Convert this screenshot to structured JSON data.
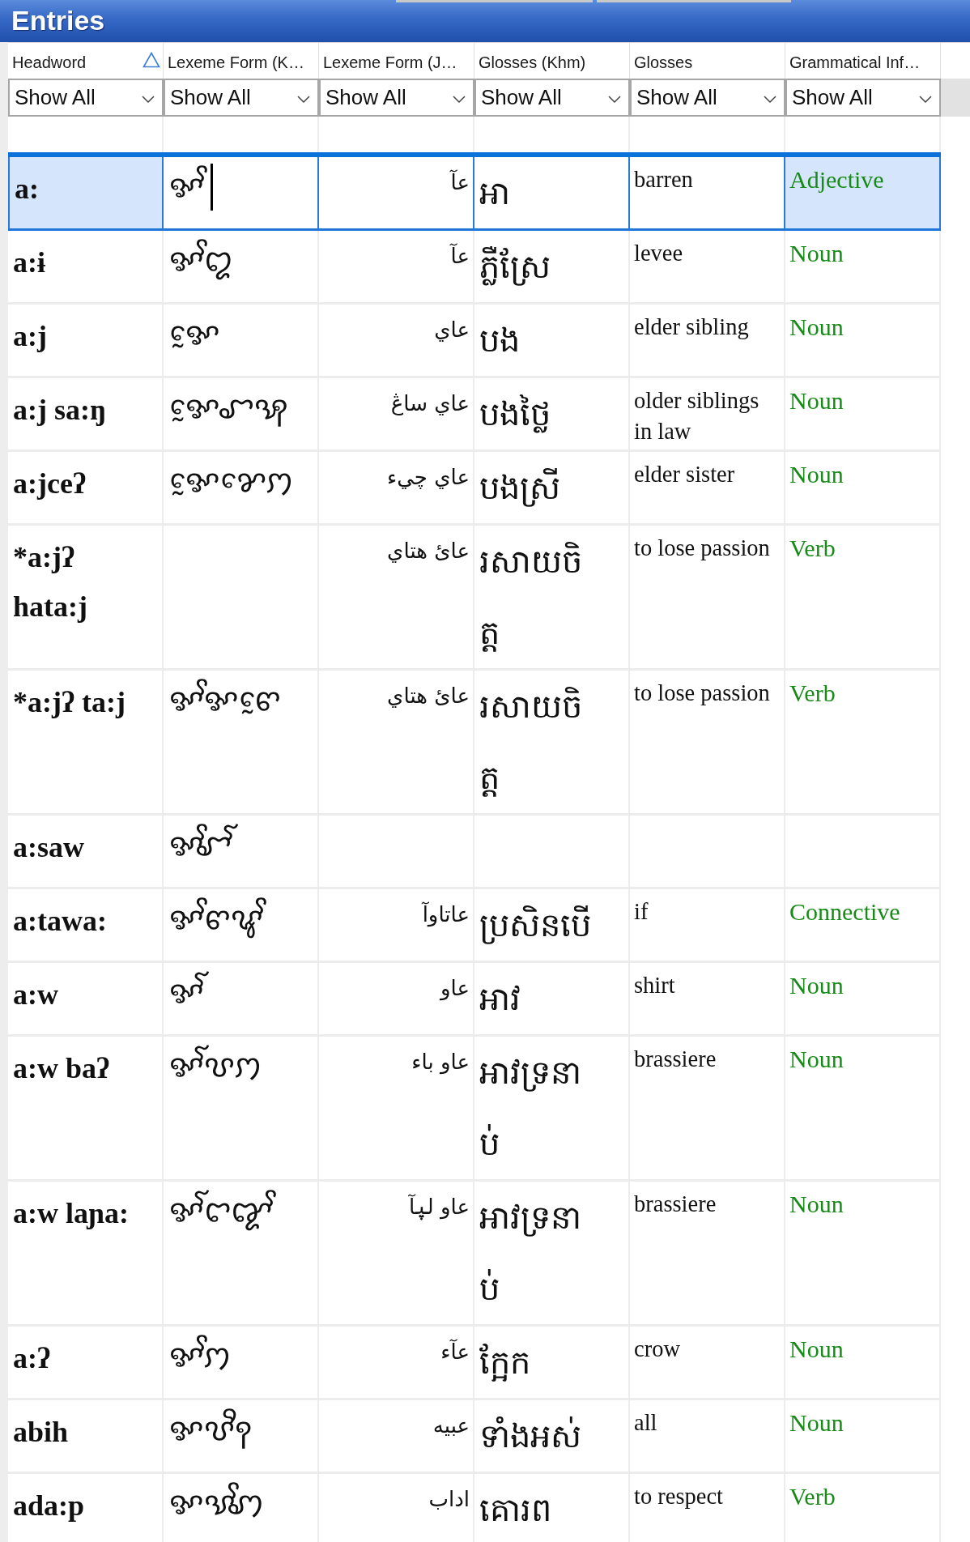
{
  "panel": {
    "title": "Entries"
  },
  "table": {
    "columns": [
      {
        "label": "Headword",
        "kind": "headword",
        "sorted": true,
        "filter": "Show All"
      },
      {
        "label": "Lexeme Form (K…",
        "kind": "cham",
        "sorted": false,
        "filter": "Show All"
      },
      {
        "label": "Lexeme Form (J…",
        "kind": "jawi",
        "sorted": false,
        "filter": "Show All"
      },
      {
        "label": "Glosses (Khm)",
        "kind": "khmer",
        "sorted": false,
        "filter": "Show All"
      },
      {
        "label": "Glosses",
        "kind": "gloss",
        "sorted": false,
        "filter": "Show All"
      },
      {
        "label": "Grammatical Inf…",
        "kind": "category",
        "sorted": false,
        "filter": "Show All"
      }
    ],
    "rows": [
      {
        "headword": "a:",
        "lexeme_form_k": "ꨀꨩ",
        "lexeme_form_j": "عآ",
        "glosses_khm": "អា",
        "glosses": "barren",
        "grammatical_info": "Adjective",
        "selected": true
      },
      {
        "headword": "a:ɨ",
        "lexeme_form_k": "ꨀꨩꨁ",
        "lexeme_form_j": "عآ",
        "glosses_khm": "ភ្លឺស្រែ",
        "glosses": "levee",
        "grammatical_info": "Noun",
        "selected": false
      },
      {
        "headword": "a:j",
        "lexeme_form_k": "ꨀꨰ",
        "lexeme_form_j": "عاي",
        "glosses_khm": "បង",
        "glosses": "elder sibling",
        "grammatical_info": "Noun",
        "selected": false
      },
      {
        "headword": "a:j sa:ŋ",
        "lexeme_form_k": "ꨀꨰꨧꩂ",
        "lexeme_form_j": "عاي ساڠ",
        "glosses_khm": "បងថ្លៃ",
        "glosses": "older siblings in law",
        "grammatical_info": "Noun",
        "selected": false
      },
      {
        "headword": "a:jceʔ",
        "lexeme_form_k": "ꨀꨰꨌꨯꩀ",
        "lexeme_form_j": "عاي چيء",
        "glosses_khm": "បងស្រី",
        "glosses": "elder sister",
        "grammatical_info": "Noun",
        "selected": false
      },
      {
        "headword": "*a:jʔ hata:j",
        "lexeme_form_j": "عائ هتاي",
        "glosses_khm": "រសាយចិត្ត",
        "glosses": "to lose passion",
        "grammatical_info": "Verb",
        "selected": false
      },
      {
        "headword": "*a:jʔ ta:j",
        "lexeme_form_k": "ꨀꨩꨀꨓꨰ",
        "lexeme_form_j": "عائ هتاي",
        "glosses_khm": "រសាយចិត្ត",
        "glosses": "to lose passion",
        "grammatical_info": "Verb",
        "selected": false
      },
      {
        "headword": "a:saw",
        "lexeme_form_k": "ꨀꨩꨧꨱ",
        "selected": false
      },
      {
        "headword": "a:tawa:",
        "lexeme_form_k": "ꨀꨩꨓꨥꨩ",
        "lexeme_form_j": "عاتاوآ",
        "glosses_khm": "ប្រសិនបើ",
        "glosses": "if",
        "grammatical_info": "Connective",
        "selected": false
      },
      {
        "headword": "a:w",
        "lexeme_form_k": "ꨀꨱ",
        "lexeme_form_j": "عاو",
        "glosses_khm": "អាវ",
        "glosses": "shirt",
        "grammatical_info": "Noun",
        "selected": false
      },
      {
        "headword": "a:w baʔ",
        "lexeme_form_k": "ꨀꨱꨝꩀ",
        "lexeme_form_j": "عاو باء",
        "glosses_khm": "អាវទ្រនាប់",
        "glosses": "brassiere",
        "grammatical_info": "Noun",
        "selected": false
      },
      {
        "headword": "a:w laɲa:",
        "lexeme_form_k": "ꨀꨱꨤꨑꨩ",
        "lexeme_form_j": "عاو لۑآ",
        "glosses_khm": "អាវទ្រនាប់",
        "glosses": "brassiere",
        "grammatical_info": "Noun",
        "selected": false
      },
      {
        "headword": "a:ʔ",
        "lexeme_form_k": "ꨀꨩꩀ",
        "lexeme_form_j": "عآء",
        "glosses_khm": "ក្អែក",
        "glosses": "crow",
        "grammatical_info": "Noun",
        "selected": false
      },
      {
        "headword": "abih",
        "lexeme_form_k": "ꨀꨝꨪꩍ",
        "lexeme_form_j": "عبيه",
        "glosses_khm": "ទាំងអស់",
        "glosses": "all",
        "grammatical_info": "Noun",
        "selected": false
      },
      {
        "headword": "ada:p",
        "lexeme_form_k": "ꨀꨕꨩꩇ",
        "lexeme_form_j": "اداب",
        "glosses_khm": "គោរព",
        "glosses": "to respect",
        "grammatical_info": "Verb",
        "selected": false
      }
    ]
  }
}
